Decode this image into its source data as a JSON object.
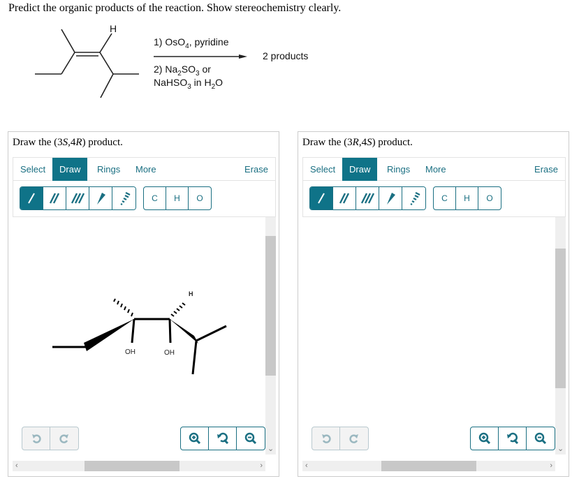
{
  "question": "Predict the organic products of the reaction. Show stereochemistry clearly.",
  "reaction": {
    "reactant_label_H": "H",
    "step1_prefix": "1) OsO",
    "step1_sub": "4",
    "step1_suffix": ", pyridine",
    "step2_line1_prefix": "2) Na",
    "step2_line1_sub1": "2",
    "step2_line1_mid": "SO",
    "step2_line1_sub2": "3",
    "step2_line1_suffix": " or",
    "step2_line2_prefix": "NaHSO",
    "step2_line2_sub1": "3",
    "step2_line2_mid": " in H",
    "step2_line2_sub2": "2",
    "step2_line2_suffix": "O",
    "product_text": "2 products"
  },
  "panels": [
    {
      "title_prefix": "Draw the (3",
      "title_c1": "S",
      "title_mid": ",4",
      "title_c2": "R",
      "title_suffix": ") product.",
      "tabs": {
        "select": "Select",
        "draw": "Draw",
        "rings": "Rings",
        "more": "More",
        "erase": "Erase"
      },
      "active_tab": "draw",
      "bond_tools": [
        "single-bond",
        "double-bond",
        "triple-bond",
        "wedge-bond",
        "hash-bond"
      ],
      "atom_tools": [
        "C",
        "H",
        "O"
      ],
      "molecule_labels": {
        "oh1": "OH",
        "oh2": "OH",
        "h": "H"
      }
    },
    {
      "title_prefix": "Draw the (3",
      "title_c1": "R",
      "title_mid": ",4",
      "title_c2": "S",
      "title_suffix": ") product.",
      "tabs": {
        "select": "Select",
        "draw": "Draw",
        "rings": "Rings",
        "more": "More",
        "erase": "Erase"
      },
      "active_tab": "draw",
      "bond_tools": [
        "single-bond",
        "double-bond",
        "triple-bond",
        "wedge-bond",
        "hash-bond"
      ],
      "atom_tools": [
        "C",
        "H",
        "O"
      ]
    }
  ],
  "colors": {
    "accent": "#0f7388",
    "accent_text": "#1a6f82",
    "disabled": "#9bb8c0"
  }
}
